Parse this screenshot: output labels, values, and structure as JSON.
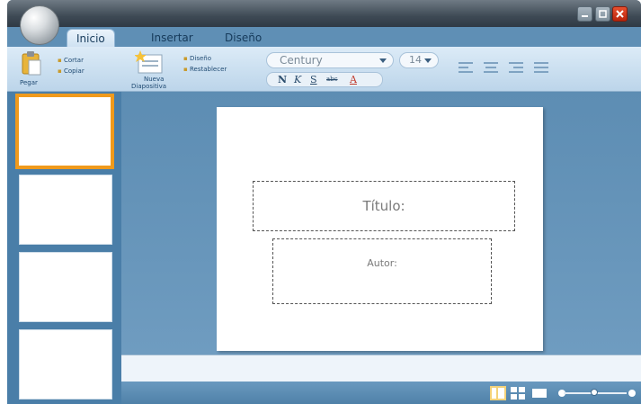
{
  "tabs": {
    "inicio": "Inicio",
    "insertar": "Insertar",
    "diseno": "Diseño"
  },
  "ribbon": {
    "paste_label": "Pegar",
    "cut_label": "Cortar",
    "copy_label": "Copiar",
    "new_slide_label_line1": "Nueva",
    "new_slide_label_line2": "Diapositiva",
    "layout_label": "Diseño",
    "reset_label": "Restablecer",
    "font_name": "Century",
    "font_size": "14",
    "bold_label": "N",
    "italic_label": "K",
    "underline_label": "S",
    "strike_label": "abc",
    "font_color_label": "A"
  },
  "slide": {
    "title_placeholder": "Título:",
    "author_placeholder": "Autor:"
  },
  "colors": {
    "selected_thumb_border": "#f09a1c",
    "close_button": "#d23a1a",
    "ribbon_bg": "#cfe2f2"
  },
  "icons": {
    "minimize": "minimize-icon",
    "maximize": "maximize-icon",
    "close": "close-icon",
    "paste": "paste-icon",
    "new_slide": "new-slide-icon"
  }
}
